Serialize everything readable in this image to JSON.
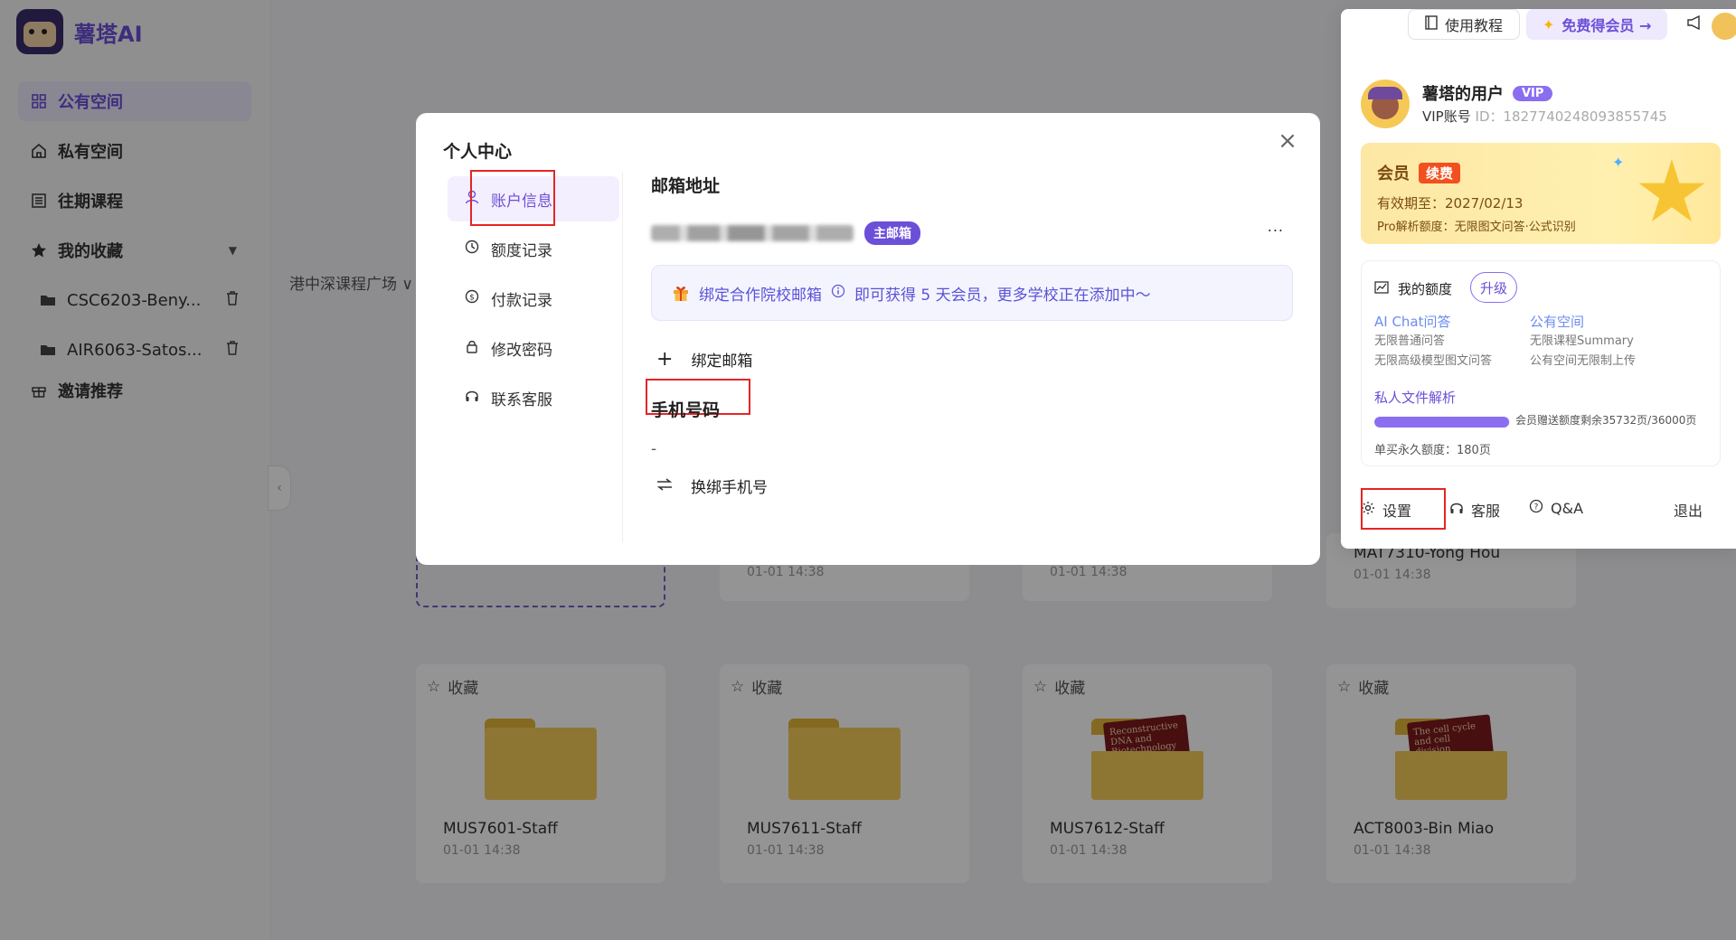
{
  "app": {
    "name": "薯塔AI"
  },
  "sidebar": {
    "items": [
      {
        "label": "公有空间",
        "icon": "grid-icon"
      },
      {
        "label": "私有空间",
        "icon": "home-icon"
      },
      {
        "label": "往期课程",
        "icon": "list-icon"
      },
      {
        "label": "我的收藏",
        "icon": "star-icon"
      }
    ],
    "favorites": [
      {
        "label": "CSC6203-Beny..."
      },
      {
        "label": "AIR6063-Satos..."
      }
    ],
    "invite": {
      "label": "邀请推荐"
    }
  },
  "main": {
    "filter_label": "港中深课程广场",
    "favorite_label": "收藏",
    "cards_top": [
      {
        "name": "",
        "date": "01-01 14:38"
      },
      {
        "name": "",
        "date": "01-01 14:38"
      },
      {
        "name": "MAT7310-Yong Hou",
        "date": "01-01 14:38"
      }
    ],
    "cards": [
      {
        "name": "MUS7601-Staff",
        "date": "01-01 14:38"
      },
      {
        "name": "MUS7611-Staff",
        "date": "01-01 14:38"
      },
      {
        "name": "MUS7612-Staff",
        "date": "01-01 14:38",
        "doc": "Reconstructive DNA and Biotechnology"
      },
      {
        "name": "ACT8003-Bin Miao",
        "date": "01-01 14:38",
        "doc": "The cell cycle and cell division"
      }
    ]
  },
  "modal": {
    "title": "个人中心",
    "close": "×",
    "nav": [
      {
        "label": "账户信息",
        "icon": "user-icon"
      },
      {
        "label": "额度记录",
        "icon": "clock-icon"
      },
      {
        "label": "付款记录",
        "icon": "dollar-icon"
      },
      {
        "label": "修改密码",
        "icon": "lock-icon"
      },
      {
        "label": "联系客服",
        "icon": "headset-icon"
      }
    ],
    "email_section": "邮箱地址",
    "primary_badge": "主邮箱",
    "more": "...",
    "promo_link": "绑定合作院校邮箱",
    "promo_text": "即可获得 5 天会员，更多学校正在添加中～",
    "bind_email": "绑定邮箱",
    "phone_section": "手机号码",
    "phone_value": "-",
    "rebind_phone": "换绑手机号"
  },
  "panel": {
    "tutorial": "使用教程",
    "free_vip": "免费得会员 →",
    "user_name": "薯塔的用户",
    "vip": "VIP",
    "id_label": "VIP账号",
    "id_value": "ID：1827740248093855745",
    "member_title": "会员",
    "renew": "续费",
    "expire": "有效期至：2027/02/13",
    "pro": "Pro解析额度：无限图文问答·公式识别",
    "quota_title": "我的额度",
    "upgrade": "升级",
    "ai_chat": {
      "title": "AI Chat问答",
      "l1": "无限普通问答",
      "l2": "无限高级模型图文问答"
    },
    "public_space": {
      "title": "公有空间",
      "l1": "无限课程Summary",
      "l2": "公有空间无限制上传"
    },
    "private_parse": "私人文件解析",
    "progress_text": "会员赠送额度剩余35732页/36000页",
    "progress_fraction": 0.9926,
    "permanent": "单买永久额度：180页",
    "footer": {
      "settings": "设置",
      "service": "客服",
      "qa": "Q&A",
      "logout": "退出"
    }
  }
}
